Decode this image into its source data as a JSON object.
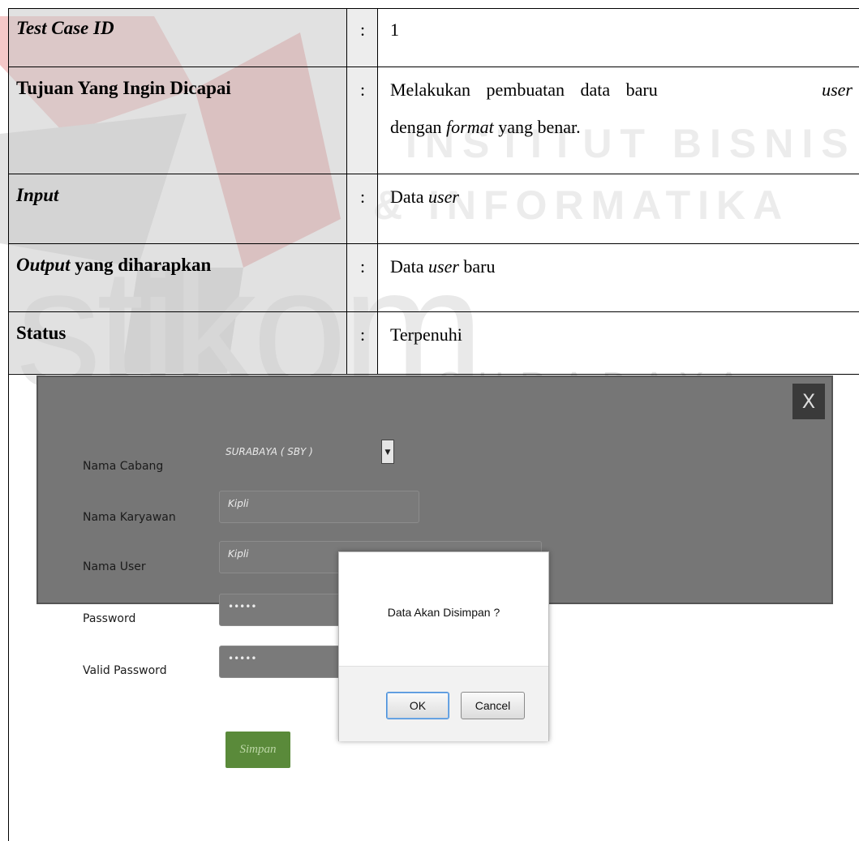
{
  "watermark": {
    "line1": "INSTITUT BISNIS",
    "line2": "& INFORMATIKA",
    "logo": "stikom",
    "city": "SURABAYA"
  },
  "table": {
    "rows": [
      {
        "label": "Test Case ID",
        "colon": ":",
        "value": "1"
      },
      {
        "label": "Tujuan Yang Ingin Dicapai",
        "colon": ":",
        "value_part1": "Melakukan pembuatan data baru",
        "value_italic1": "user",
        "value_part2": "dengan",
        "value_italic2": "format",
        "value_part3": "yang benar."
      },
      {
        "label": "Input",
        "colon": ":",
        "value_part1": "Data",
        "value_italic1": "user"
      },
      {
        "label_italic": "Output",
        "label_rest": "yang diharapkan",
        "colon": ":",
        "value_part1": "Data",
        "value_italic1": "user",
        "value_part2": "baru"
      },
      {
        "label": "Status",
        "colon": ":",
        "value": "Terpenuhi"
      }
    ]
  },
  "form": {
    "close_label": "X",
    "fields": [
      {
        "label": "Nama Cabang",
        "value": "SURABAYA ( SBY )"
      },
      {
        "label": "Nama Karyawan",
        "value": "Kipli"
      },
      {
        "label": "Nama User",
        "value": "Kipli"
      },
      {
        "label": "Password",
        "value": "•••••"
      },
      {
        "label": "Valid Password",
        "value": "•••••"
      }
    ],
    "submit_label": "Simpan"
  },
  "dialog": {
    "message": "Data Akan Disimpan ?",
    "ok_label": "OK",
    "cancel_label": "Cancel"
  },
  "colors": {
    "panel_bg": "#767676",
    "submit_bg": "#5a8a3a",
    "ok_focus": "#4a90d9"
  }
}
